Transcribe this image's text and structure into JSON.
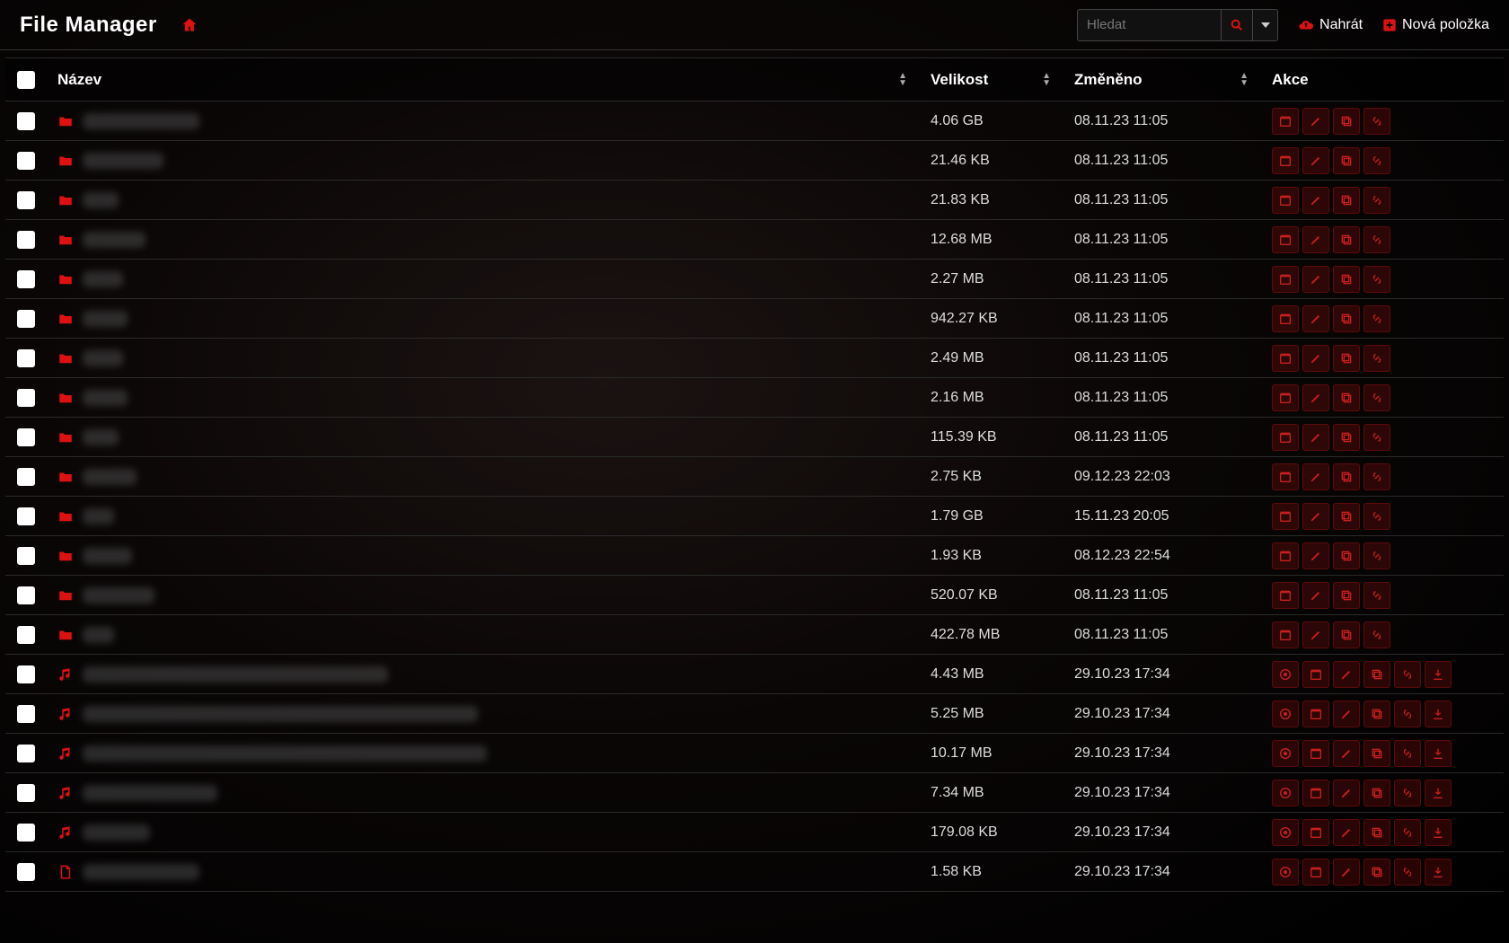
{
  "header": {
    "title": "File Manager",
    "search_placeholder": "Hledat",
    "upload_label": "Nahrát",
    "new_item_label": "Nová položka"
  },
  "columns": {
    "name": "Název",
    "size": "Velikost",
    "modified": "Změněno",
    "actions": "Akce"
  },
  "icons": {
    "folder": "folder-icon",
    "music": "music-icon",
    "file": "file-icon"
  },
  "folder_actions": [
    "open",
    "rename",
    "copy",
    "link"
  ],
  "file_actions": [
    "preview",
    "open",
    "rename",
    "copy",
    "link",
    "download"
  ],
  "rows": [
    {
      "type": "folder",
      "name_width": 130,
      "size": "4.06 GB",
      "modified": "08.11.23 11:05"
    },
    {
      "type": "folder",
      "name_width": 90,
      "size": "21.46 KB",
      "modified": "08.11.23 11:05"
    },
    {
      "type": "folder",
      "name_width": 40,
      "size": "21.83 KB",
      "modified": "08.11.23 11:05"
    },
    {
      "type": "folder",
      "name_width": 70,
      "size": "12.68 MB",
      "modified": "08.11.23 11:05"
    },
    {
      "type": "folder",
      "name_width": 45,
      "size": "2.27 MB",
      "modified": "08.11.23 11:05"
    },
    {
      "type": "folder",
      "name_width": 50,
      "size": "942.27 KB",
      "modified": "08.11.23 11:05"
    },
    {
      "type": "folder",
      "name_width": 45,
      "size": "2.49 MB",
      "modified": "08.11.23 11:05"
    },
    {
      "type": "folder",
      "name_width": 50,
      "size": "2.16 MB",
      "modified": "08.11.23 11:05"
    },
    {
      "type": "folder",
      "name_width": 40,
      "size": "115.39 KB",
      "modified": "08.11.23 11:05"
    },
    {
      "type": "folder",
      "name_width": 60,
      "size": "2.75 KB",
      "modified": "09.12.23 22:03"
    },
    {
      "type": "folder",
      "name_width": 35,
      "size": "1.79 GB",
      "modified": "15.11.23 20:05"
    },
    {
      "type": "folder",
      "name_width": 55,
      "size": "1.93 KB",
      "modified": "08.12.23 22:54"
    },
    {
      "type": "folder",
      "name_width": 80,
      "size": "520.07 KB",
      "modified": "08.11.23 11:05"
    },
    {
      "type": "folder",
      "name_width": 35,
      "size": "422.78 MB",
      "modified": "08.11.23 11:05"
    },
    {
      "type": "music",
      "name_width": 340,
      "size": "4.43 MB",
      "modified": "29.10.23 17:34"
    },
    {
      "type": "music",
      "name_width": 440,
      "size": "5.25 MB",
      "modified": "29.10.23 17:34"
    },
    {
      "type": "music",
      "name_width": 450,
      "size": "10.17 MB",
      "modified": "29.10.23 17:34"
    },
    {
      "type": "music",
      "name_width": 150,
      "size": "7.34 MB",
      "modified": "29.10.23 17:34"
    },
    {
      "type": "music",
      "name_width": 75,
      "size": "179.08 KB",
      "modified": "29.10.23 17:34"
    },
    {
      "type": "file",
      "name_width": 130,
      "size": "1.58 KB",
      "modified": "29.10.23 17:34"
    }
  ]
}
